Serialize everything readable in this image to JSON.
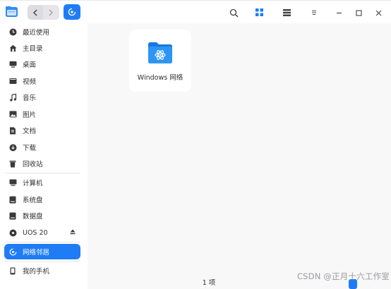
{
  "toolbar": {
    "app_icon": "file-manager-icon",
    "back_icon": "chevron-left-icon",
    "forward_icon": "chevron-right-icon",
    "location_icon": "network-icon",
    "search_icon": "search-icon",
    "icon_view_icon": "grid-view-icon",
    "list_view_icon": "list-view-icon",
    "menu_icon": "menu-icon",
    "minimize_icon": "minimize-icon",
    "maximize_icon": "maximize-icon",
    "close_icon": "close-icon",
    "accent": "#1f7cf5"
  },
  "sidebar": {
    "items": [
      {
        "label": "最近使用",
        "icon": "clock-icon"
      },
      {
        "label": "主目录",
        "icon": "home-icon"
      },
      {
        "label": "桌面",
        "icon": "desktop-icon"
      },
      {
        "label": "视频",
        "icon": "video-icon"
      },
      {
        "label": "音乐",
        "icon": "music-icon"
      },
      {
        "label": "图片",
        "icon": "picture-icon"
      },
      {
        "label": "文档",
        "icon": "document-icon"
      },
      {
        "label": "下载",
        "icon": "download-icon"
      },
      {
        "label": "回收站",
        "icon": "trash-icon"
      },
      {
        "label": "计算机",
        "icon": "computer-icon"
      },
      {
        "label": "系统盘",
        "icon": "disk-icon"
      },
      {
        "label": "数据盘",
        "icon": "disk-icon"
      },
      {
        "label": "UOS 20",
        "icon": "disc-icon"
      },
      {
        "label": "网络邻居",
        "icon": "network-icon",
        "active": true
      },
      {
        "label": "我的手机",
        "icon": "phone-icon"
      }
    ]
  },
  "main": {
    "items": [
      {
        "label": "Windows 网络",
        "icon": "network-folder-icon"
      }
    ],
    "status": "1 项"
  },
  "watermark": "CSDN @正月十六工作室"
}
